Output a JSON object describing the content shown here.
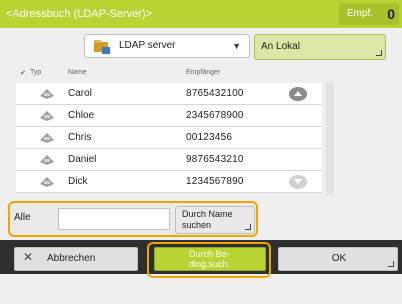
{
  "header": {
    "title": "<Adressbuch (LDAP-Server)>",
    "recipients_label": "Empf.",
    "recipients_count": "0"
  },
  "server": {
    "selected": "LDAP server",
    "icon": "folder-network-icon"
  },
  "to_local_button": "An Lokal",
  "table": {
    "columns": [
      "Typ",
      "Name",
      "Empfänger"
    ],
    "rows": [
      {
        "name": "Carol",
        "number": "8765432100"
      },
      {
        "name": "Chloe",
        "number": "2345678900"
      },
      {
        "name": "Chris",
        "number": "00123456"
      },
      {
        "name": "Daniel",
        "number": "9876543210"
      },
      {
        "name": "Dick",
        "number": "1234567890"
      }
    ]
  },
  "search": {
    "field_label": "Alle",
    "value": "",
    "button_label": "Durch Name suchen"
  },
  "footer": {
    "cancel_label": "Abbrechen",
    "condition_search_label": "Durch Be­ding.such.",
    "ok_label": "OK"
  },
  "colors": {
    "accent": "#b8d433",
    "highlight": "#f0a400"
  }
}
